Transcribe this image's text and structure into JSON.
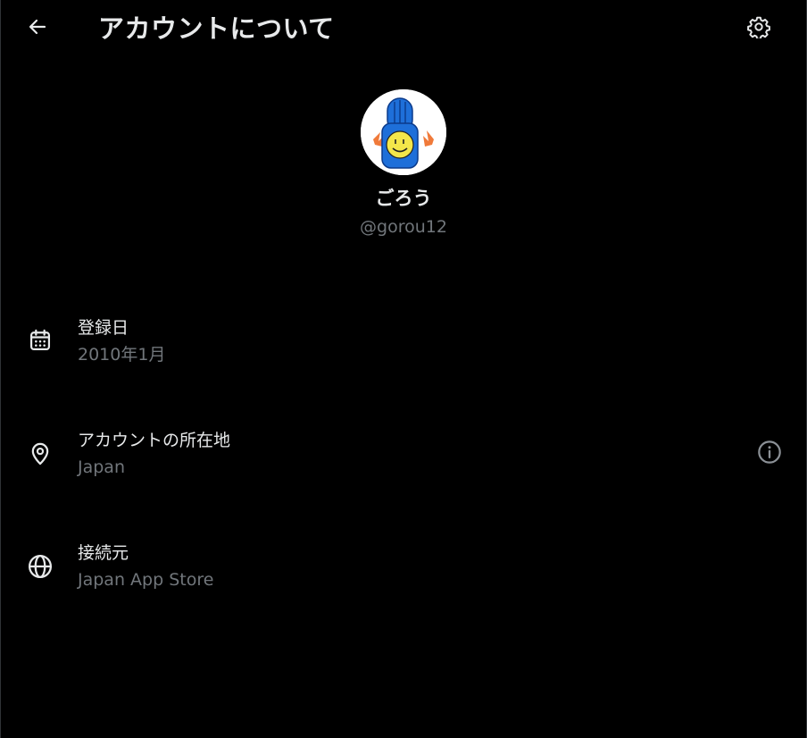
{
  "header": {
    "title": "アカウントについて",
    "back_icon": "arrow-left-icon",
    "settings_icon": "gear-icon"
  },
  "profile": {
    "display_name": "ごろう",
    "handle": "@gorou12"
  },
  "info_rows": [
    {
      "icon": "calendar-icon",
      "label": "登録日",
      "value": "2010年1月"
    },
    {
      "icon": "location-pin-icon",
      "label": "アカウントの所在地",
      "value": "Japan",
      "trailing_icon": "info-icon"
    },
    {
      "icon": "globe-icon",
      "label": "接続元",
      "value": "Japan App Store"
    }
  ],
  "colors": {
    "background": "#000000",
    "primary_text": "#e7e9ea",
    "secondary_text": "#71767b"
  }
}
